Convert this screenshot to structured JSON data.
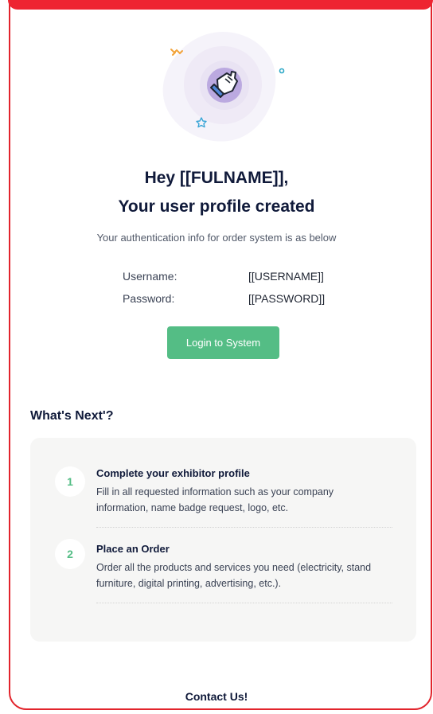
{
  "colors": {
    "brand_red": "#ee2431",
    "accent_green": "#54bd85",
    "heading_navy": "#101a3a"
  },
  "hero": {
    "icon": "waving-hand-icon"
  },
  "greeting": {
    "line1": "Hey [[FULNAME]],",
    "line2": "Your user profile created"
  },
  "subtitle": "Your authentication info for order system is as below",
  "credentials": {
    "username_label": "Username:",
    "username_value": "[[USERNAME]]",
    "password_label": "Password:",
    "password_value": "[[PASSWORD]]"
  },
  "login_button": "Login to System",
  "whats_next": {
    "heading": "What's Next'?",
    "steps": [
      {
        "number": "1",
        "title": "Complete your exhibitor profile",
        "line1": "Fill in all requested information such as your company",
        "line2": "information, name badge request, logo, etc."
      },
      {
        "number": "2",
        "title": "Place an Order",
        "line1": "Order all the products and services you need (electricity, stand",
        "line2": "furniture, digital printing, advertising, etc.)."
      }
    ]
  },
  "contact": "Contact Us!"
}
